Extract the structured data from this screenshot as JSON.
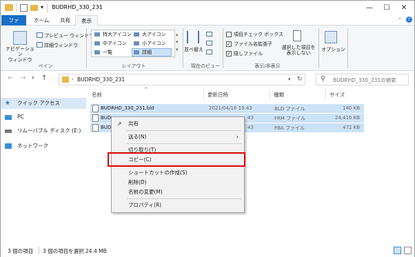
{
  "window": {
    "title": "BUDRHD_330_231"
  },
  "tabs": [
    {
      "label": "ファイル"
    },
    {
      "label": "ホーム"
    },
    {
      "label": "共有"
    },
    {
      "label": "表示"
    }
  ],
  "ribbon": {
    "panes": {
      "navigation_pane": "ナビゲーション\nウィンドウ",
      "preview_pane": "プレビュー ウィンドウ",
      "details_pane": "詳細ウィンドウ",
      "group_label": "ペイン"
    },
    "layout": {
      "items": [
        "特大アイコン",
        "大アイコン",
        "中アイコン",
        "小アイコン",
        "一覧",
        "詳細"
      ],
      "group_label": "レイアウト"
    },
    "current_view": {
      "sort_label": "並べ替え",
      "group_label": "現在のビュー"
    },
    "show_hide": {
      "item_checkboxes": "項目チェック ボックス",
      "file_extensions": "ファイル名拡張子",
      "hidden_items": "隠しファイル",
      "hide_selected": "選択した項目を\n表示しない",
      "group_label": "表示/非表示"
    },
    "options_label": "オプション"
  },
  "address": {
    "path": "BUDRHD_330_231",
    "search_placeholder": "BUDRHD_330_231の検索"
  },
  "nav": {
    "items": [
      {
        "label": "クイック アクセス"
      },
      {
        "label": "PC"
      },
      {
        "label": "リムーバブル ディスク (E:)"
      },
      {
        "label": "ネットワーク"
      }
    ]
  },
  "columns": {
    "name": "名前",
    "date": "更新日時",
    "type": "種類",
    "size": "サイズ"
  },
  "files": [
    {
      "name": "BUDRHD_330_231.bld",
      "date": "2021/04/16 19:43",
      "type": "BLD ファイル",
      "size": "140 KB"
    },
    {
      "name": "BUD",
      "date": "43",
      "type": "FRM ファイル",
      "size": "24,410 KB"
    },
    {
      "name": "BUD",
      "date": "43",
      "type": "PBA ファイル",
      "size": "472 KB"
    }
  ],
  "context_menu": {
    "items": [
      {
        "label": "共有"
      },
      {
        "label": "送る(N)"
      },
      {
        "label": "切り取り(T)"
      },
      {
        "label": "コピー(C)"
      },
      {
        "label": "ショートカットの作成(S)"
      },
      {
        "label": "削除(D)"
      },
      {
        "label": "名前の変更(M)"
      },
      {
        "label": "プロパティ(R)"
      }
    ]
  },
  "status": {
    "count": "3 個の項目",
    "selected": "3 個の項目を選択  24.4 MB"
  },
  "colors": {
    "accent": "#1a6ec3",
    "selection": "#cce2f7",
    "highlight_box": "#e00000"
  }
}
